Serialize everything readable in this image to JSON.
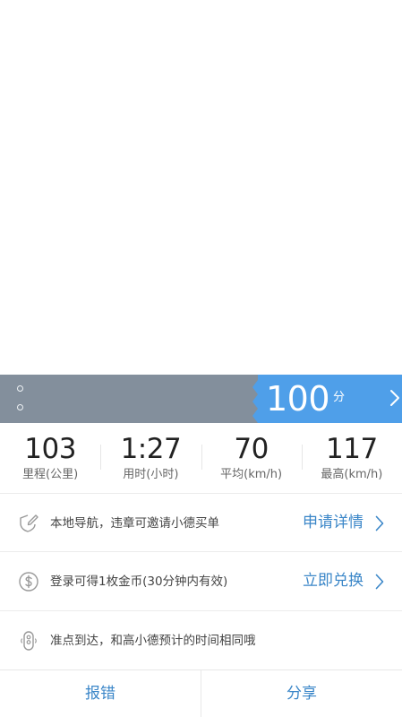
{
  "colors": {
    "accent": "#3a86c8",
    "score_bg": "#4f9fe9",
    "route_bar": "#838f9c"
  },
  "score": {
    "value": "100",
    "unit": "分"
  },
  "stats": [
    {
      "value": "103",
      "label": "里程(公里)"
    },
    {
      "value": "1:27",
      "label": "用时(小时)"
    },
    {
      "value": "70",
      "label": "平均(km/h)"
    },
    {
      "value": "117",
      "label": "最高(km/h)"
    }
  ],
  "rows": [
    {
      "icon": "shield-pen-icon",
      "text": "本地导航，违章可邀请小德买单",
      "action": "申请详情"
    },
    {
      "icon": "dollar-coin-icon",
      "text": "登录可得1枚金币(30分钟内有效)",
      "action": "立即兑换"
    },
    {
      "icon": "traffic-light-icon",
      "text": "准点到达，和高小德预计的时间相同哦",
      "action": ""
    }
  ],
  "bottom": {
    "report_label": "报错",
    "share_label": "分享"
  }
}
